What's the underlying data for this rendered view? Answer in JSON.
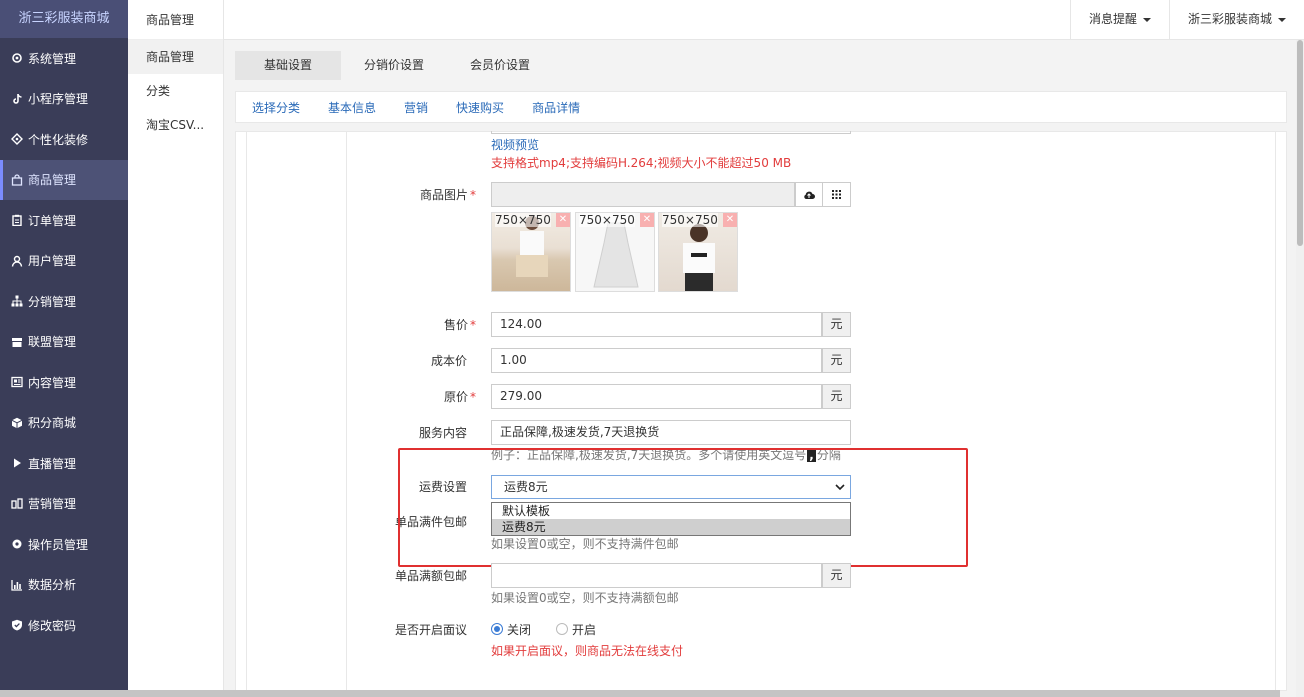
{
  "brand": "浙三彩服装商城",
  "sidebar": {
    "items": [
      {
        "label": "系统管理",
        "icon": "gear-icon"
      },
      {
        "label": "小程序管理",
        "icon": "tiktok-icon"
      },
      {
        "label": "个性化装修",
        "icon": "diamond-icon"
      },
      {
        "label": "商品管理",
        "icon": "bag-icon",
        "active": true
      },
      {
        "label": "订单管理",
        "icon": "clipboard-icon"
      },
      {
        "label": "用户管理",
        "icon": "user-icon"
      },
      {
        "label": "分销管理",
        "icon": "sitemap-icon"
      },
      {
        "label": "联盟管理",
        "icon": "store-icon"
      },
      {
        "label": "内容管理",
        "icon": "newspaper-icon"
      },
      {
        "label": "积分商城",
        "icon": "cube-icon"
      },
      {
        "label": "直播管理",
        "icon": "play-icon"
      },
      {
        "label": "营销管理",
        "icon": "handshake-icon"
      },
      {
        "label": "操作员管理",
        "icon": "cog-icon"
      },
      {
        "label": "数据分析",
        "icon": "bar-chart-icon"
      },
      {
        "label": "修改密码",
        "icon": "shield-icon"
      }
    ]
  },
  "subnav": {
    "title": "商品管理",
    "items": [
      "商品管理",
      "分类",
      "淘宝CSV..."
    ]
  },
  "header": {
    "notify": "消息提醒",
    "shop": "浙三彩服装商城"
  },
  "tabs": [
    "基础设置",
    "分销价设置",
    "会员价设置"
  ],
  "section_links": [
    "选择分类",
    "基本信息",
    "营销",
    "快速购买",
    "商品详情"
  ],
  "form": {
    "video_preview": "视频预览",
    "video_hint": "支持格式mp4;支持编码H.264;视频大小不能超过50 MB",
    "images_label": "商品图片",
    "image_caption": "750×750",
    "price_label": "售价",
    "price": "124.00",
    "cost_label": "成本价",
    "cost": "1.00",
    "orig_label": "原价",
    "orig": "279.00",
    "unit": "元",
    "service_label": "服务内容",
    "service": "正品保障,极速发货,7天退换货",
    "service_hint": "例子：正品保障,极速发货,7天退换货。多个请使用英文逗号",
    "service_hint_tail": "分隔",
    "comma": ",",
    "freight_label": "运费设置",
    "freight_value": "运费8元",
    "freight_options": [
      "默认模板",
      "运费8元"
    ],
    "free_count_label": "单品满件包邮",
    "free_count_hint": "如果设置0或空，则不支持满件包邮",
    "free_amount_label": "单品满额包邮",
    "free_amount_hint": "如果设置0或空，则不支持满额包邮",
    "negotiable_label": "是否开启面议",
    "off_label": "关闭",
    "on_label": "开启",
    "negotiable_hint": "如果开启面议，则商品无法在线支付"
  }
}
